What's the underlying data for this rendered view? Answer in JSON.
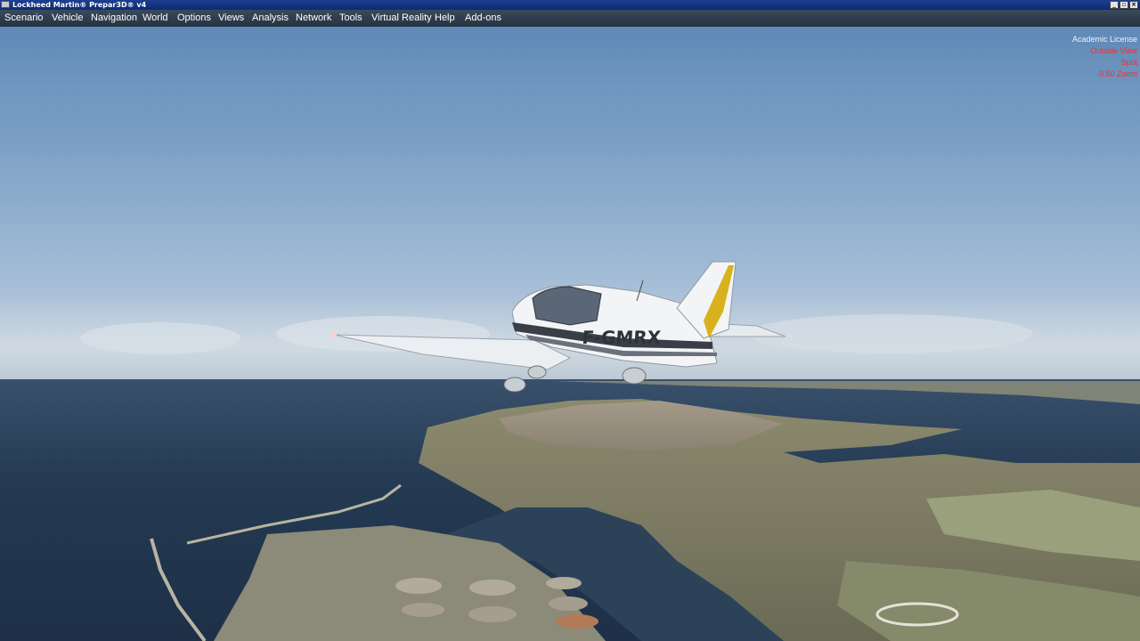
{
  "window": {
    "title": "Lockheed Martin® Prepar3D® v4",
    "controls": [
      "minimize-icon",
      "restore-icon",
      "close-icon"
    ]
  },
  "menu": [
    "Scenario",
    "Vehicle",
    "Navigation",
    "World",
    "Options",
    "Views",
    "Analysis",
    "Network",
    "Tools",
    "Virtual Reality",
    "Help",
    "Add-ons"
  ],
  "hud": {
    "license": "Academic License",
    "view": "Outside View",
    "camera": "Spot",
    "zoom": "0.50 Zoom"
  },
  "aircraft": {
    "registration": "F-GMRX"
  },
  "colors": {
    "hud_red": "#ff2a2a",
    "tail_stripe": "#d8b21e"
  }
}
